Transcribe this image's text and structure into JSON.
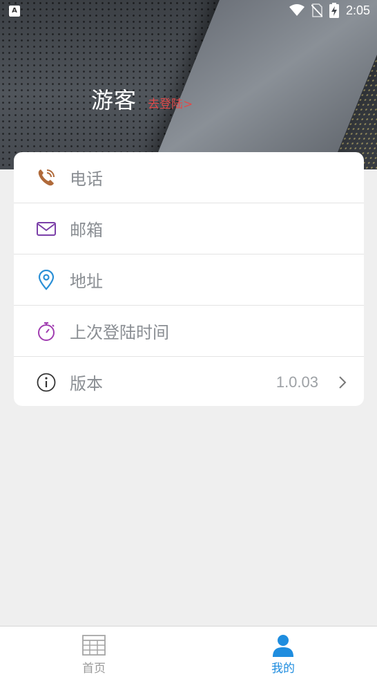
{
  "status_bar": {
    "time": "2:05"
  },
  "profile": {
    "name": "游客",
    "login_link": "去登陆>"
  },
  "menu": [
    {
      "icon": "phone-icon",
      "label": "电话",
      "value": ""
    },
    {
      "icon": "mail-icon",
      "label": "邮箱",
      "value": ""
    },
    {
      "icon": "location-pin-icon",
      "label": "地址",
      "value": ""
    },
    {
      "icon": "stopwatch-icon",
      "label": "上次登陆时间",
      "value": ""
    },
    {
      "icon": "info-icon",
      "label": "版本",
      "value": "1.0.03"
    }
  ],
  "tabs": [
    {
      "icon": "grid-table-icon",
      "label": "首页",
      "active": false
    },
    {
      "icon": "person-icon",
      "label": "我的",
      "active": true
    }
  ],
  "colors": {
    "accent": "#1f8ddf",
    "login_link": "#e04a4a",
    "phone_icon": "#b06a3a",
    "mail_icon": "#7b3fa8",
    "pin_icon": "#2a8fd6",
    "stopwatch_icon": "#a03cb0"
  }
}
